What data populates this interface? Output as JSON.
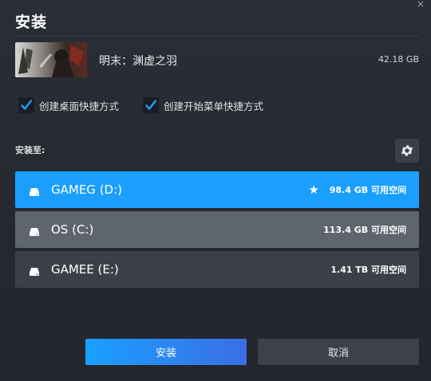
{
  "dialog": {
    "title": "安装",
    "close_glyph": "×"
  },
  "game": {
    "name": "明末：渊虚之羽",
    "size": "42.18 GB"
  },
  "options": [
    {
      "label": "创建桌面快捷方式",
      "checked": true
    },
    {
      "label": "创建开始菜单快捷方式",
      "checked": true
    }
  ],
  "install_to": {
    "label": "安装至:",
    "settings_icon": "gear-icon"
  },
  "drives": [
    {
      "name": "GAMEG (D:)",
      "free": "98.4 GB 可用空间",
      "starred": true,
      "state": "selected"
    },
    {
      "name": "OS (C:)",
      "free": "113.4 GB 可用空间",
      "starred": false,
      "state": "hover"
    },
    {
      "name": "GAMEE (E:)",
      "free": "1.41 TB 可用空间",
      "starred": false,
      "state": "normal"
    }
  ],
  "buttons": {
    "install_label": "安装",
    "cancel_label": "取消"
  },
  "colors": {
    "accent": "#1a9fff",
    "accent_gradient_end": "#3b6ee6",
    "background": "#23262d",
    "row_normal": "#3b4048",
    "row_hover": "#5f656e"
  }
}
